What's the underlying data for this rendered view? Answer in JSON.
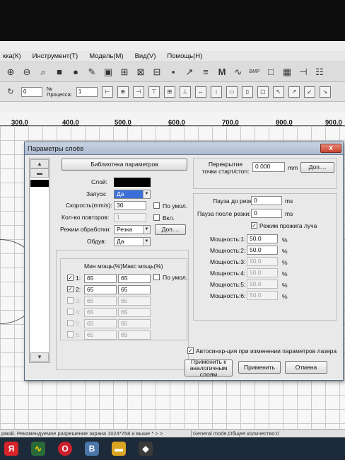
{
  "menu": [
    "кка(К)",
    "Инструмент(Т)",
    "Модель(М)",
    "Вид(V)",
    "Помощь(Н)"
  ],
  "toolbar_icons": [
    "zoom-in-icon",
    "zoom-out-icon",
    "zoom-fit-icon",
    "stop-icon",
    "circle-icon",
    "pen-icon",
    "monitor-icon",
    "layers-icon",
    "layers-2-icon",
    "layers-3-icon",
    "tape-icon",
    "wand-icon",
    "text-icon",
    "m-icon",
    "wave-icon",
    "bmp-icon",
    "square-icon",
    "grid-icon",
    "split-icon",
    "table-icon"
  ],
  "toolbar2": {
    "angle_value": "0",
    "number_label": "№",
    "processes_label": "Процесса:",
    "processes_value": "1"
  },
  "ruler_ticks": [
    "300.0",
    "400.0",
    "500.0",
    "600.0",
    "700.0",
    "800.0",
    "900.0"
  ],
  "dialog": {
    "title": "Параметры слоёв",
    "close": "x",
    "library_button": "Библиотека параметров",
    "layer_label": "Слой:",
    "start_label": "Запуск:",
    "start_value": "Да",
    "speed_label": "Скорость(mm/s):",
    "speed_value": "30",
    "speed_default_label": "По умол.",
    "repeat_label": "Кол-во повторов:",
    "repeat_value": "1",
    "repeat_enable_label": "Вкл.",
    "mode_label": "Режим обработки:",
    "mode_value": "Резка",
    "mode_more_button": "Доп....",
    "blow_label": "Обдув:",
    "blow_value": "Да",
    "power_header": "Мин мощь(%)Макс мощь(%)",
    "power_default_label": "По умол.",
    "power_rows": [
      {
        "index": "1:",
        "min": "65",
        "max": "65",
        "checked": true,
        "enabled": true
      },
      {
        "index": "2:",
        "min": "65",
        "max": "65",
        "checked": true,
        "enabled": true
      },
      {
        "index": "3:",
        "min": "65",
        "max": "65",
        "checked": false,
        "enabled": false
      },
      {
        "index": "4:",
        "min": "65",
        "max": "65",
        "checked": false,
        "enabled": false
      },
      {
        "index": "5:",
        "min": "65",
        "max": "65",
        "checked": false,
        "enabled": false
      },
      {
        "index": "6:",
        "min": "65",
        "max": "65",
        "checked": false,
        "enabled": false
      }
    ],
    "overlap_label": "Перекрытие точки старт/стоп:",
    "overlap_value": "0.000",
    "overlap_unit": "mm",
    "overlap_more_button": "Доп....",
    "pause_before_label": "Пауза до резки:",
    "pause_before_value": "0",
    "pause_before_unit": "ms",
    "pause_after_label": "Пауза после резки:",
    "pause_after_value": "0",
    "pause_after_unit": "ms",
    "pierce_label": "Режим прожига луча",
    "power_levels": [
      {
        "label": "Мощность:1:",
        "value": "50.0",
        "unit": "%",
        "enabled": true
      },
      {
        "label": "Мощность:2:",
        "value": "50.0",
        "unit": "%",
        "enabled": true
      },
      {
        "label": "Мощность:3:",
        "value": "50.0",
        "unit": "%",
        "enabled": false
      },
      {
        "label": "Мощность:4:",
        "value": "50.0",
        "unit": "%",
        "enabled": false
      },
      {
        "label": "Мощность:5:",
        "value": "50.0",
        "unit": "%",
        "enabled": false
      },
      {
        "label": "Мощность:6:",
        "value": "50.0",
        "unit": "%",
        "enabled": false
      }
    ],
    "autosync_label": "Автосинхр-ция при изменении параметров лазера",
    "apply_similar_button": "Применить к аналогичным слоям",
    "apply_button": "Применить",
    "cancel_button": "Отмена"
  },
  "status": {
    "left": "рмой. Рекомендуемое разрешение экрана 1024*768 и выше * > >",
    "right": "General mode,Общее количество:0"
  },
  "taskbar": [
    "yandex-icon",
    "app-icon",
    "opera-icon",
    "vk-icon",
    "folder-icon",
    "laser-app-icon"
  ],
  "colors": {
    "titlebar": "#aebbd0",
    "close": "#c9432e",
    "highlight": "#3a6fd8"
  }
}
